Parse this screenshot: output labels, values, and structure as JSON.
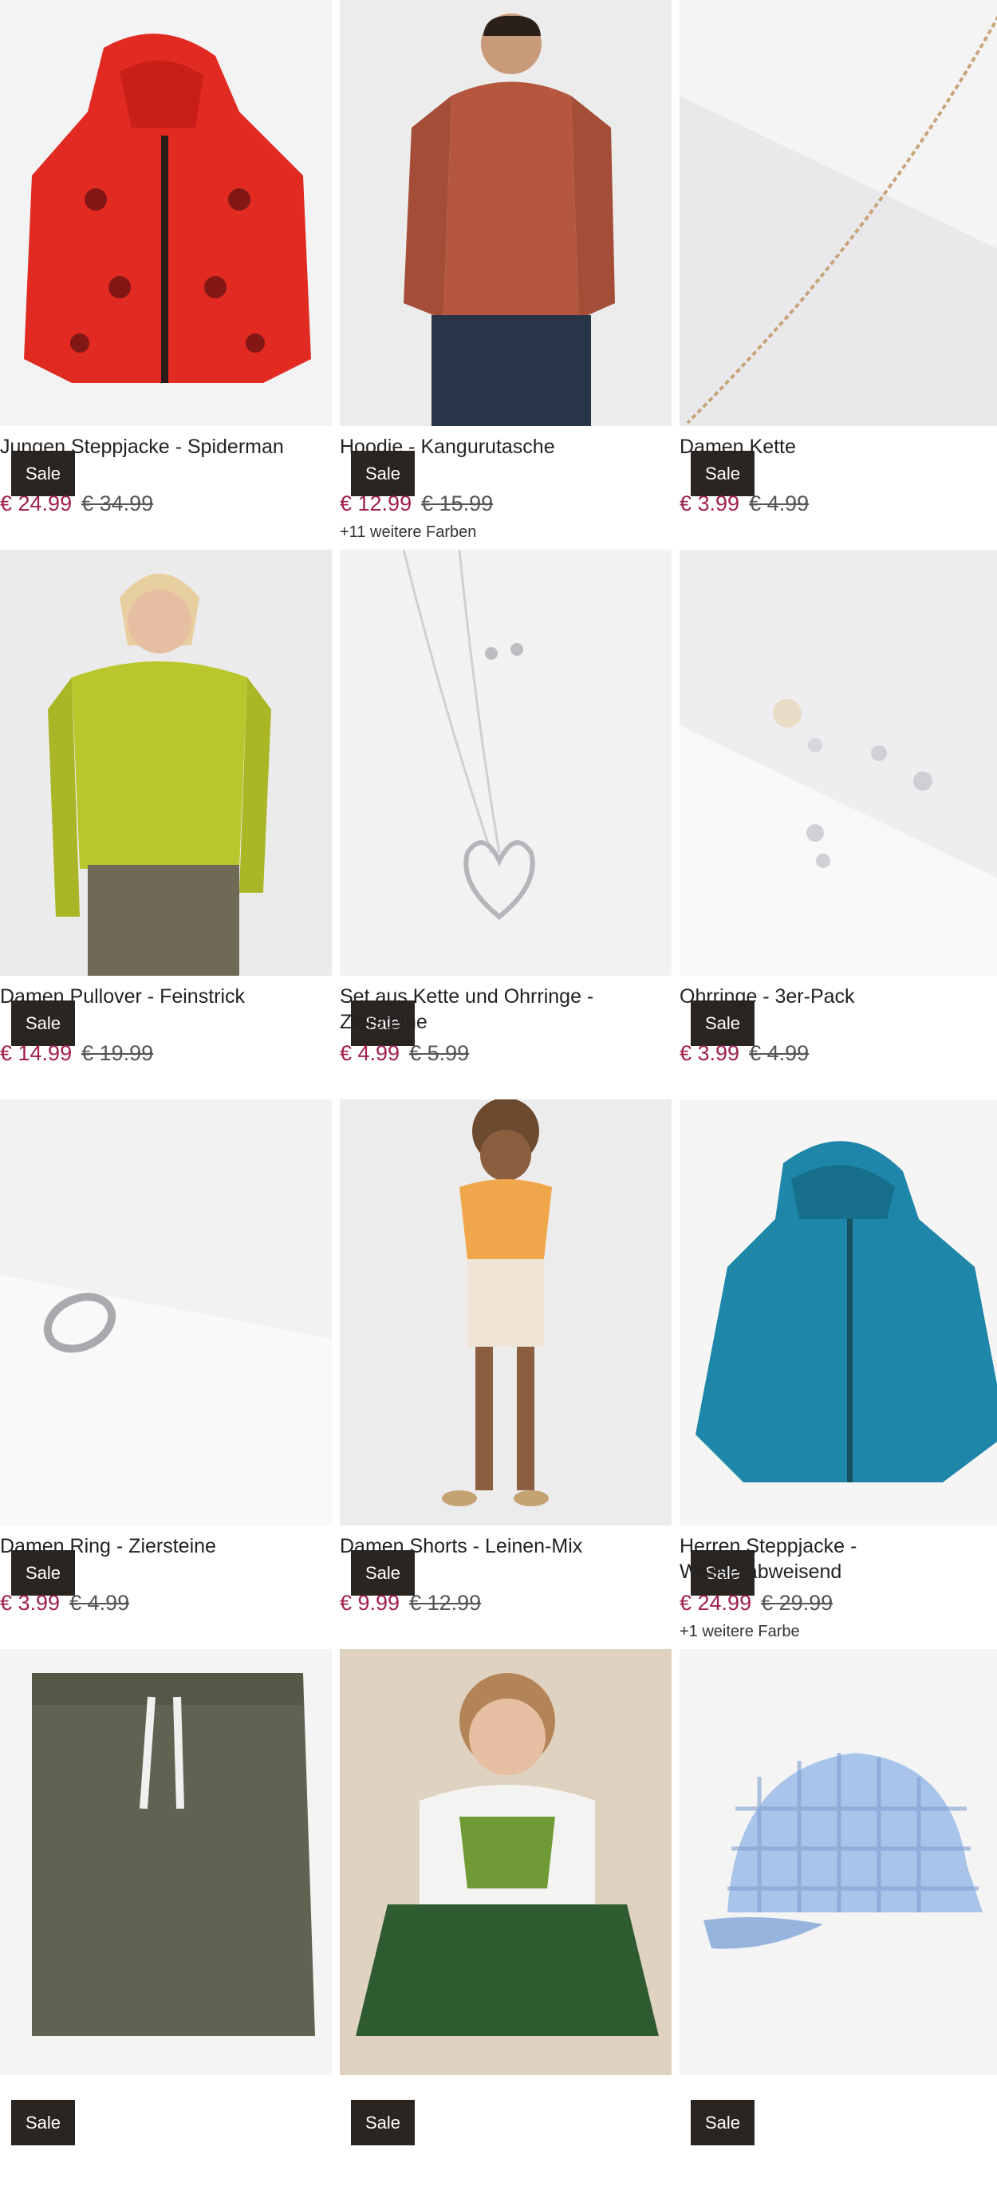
{
  "products": [
    {
      "title": "Jungen Steppjacke - Spiderman",
      "price": "€ 24.99",
      "old_price": "€ 34.99",
      "badge": "Sale",
      "colors": ""
    },
    {
      "title": "Hoodie - Kangurutasche",
      "price": "€ 12.99",
      "old_price": "€ 15.99",
      "badge": "Sale",
      "colors": "+11 weitere Farben"
    },
    {
      "title": "Damen Kette",
      "price": "€ 3.99",
      "old_price": "€ 4.99",
      "badge": "Sale",
      "colors": ""
    },
    {
      "title": "Damen Pullover - Feinstrick",
      "price": "€ 14.99",
      "old_price": "€ 19.99",
      "badge": "Sale",
      "colors": ""
    },
    {
      "title": "Set aus Kette und Ohrringe - Ziersteine",
      "price": "€ 4.99",
      "old_price": "€ 5.99",
      "badge": "Sale",
      "colors": ""
    },
    {
      "title": "Ohrringe - 3er-Pack",
      "price": "€ 3.99",
      "old_price": "€ 4.99",
      "badge": "Sale",
      "colors": ""
    },
    {
      "title": "Damen Ring - Ziersteine",
      "price": "€ 3.99",
      "old_price": "€ 4.99",
      "badge": "Sale",
      "colors": ""
    },
    {
      "title": "Damen Shorts - Leinen-Mix",
      "price": "€ 9.99",
      "old_price": "€ 12.99",
      "badge": "Sale",
      "colors": ""
    },
    {
      "title": "Herren Steppjacke - Wasserabweisend",
      "price": "€ 24.99",
      "old_price": "€ 29.99",
      "badge": "Sale",
      "colors": "+1 weitere Farbe"
    },
    {
      "title": "",
      "price": "",
      "old_price": "",
      "badge": "Sale",
      "colors": ""
    },
    {
      "title": "",
      "price": "",
      "old_price": "",
      "badge": "Sale",
      "colors": ""
    },
    {
      "title": "",
      "price": "",
      "old_price": "",
      "badge": "Sale",
      "colors": ""
    }
  ]
}
